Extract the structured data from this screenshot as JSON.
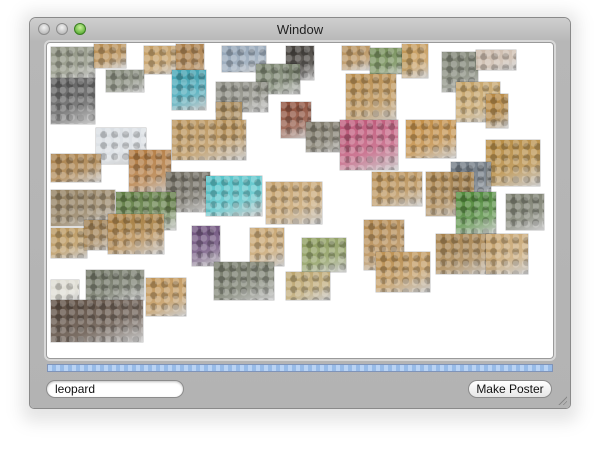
{
  "window": {
    "title": "Window"
  },
  "toolbar": {
    "search_value": "leopard",
    "make_poster_label": "Make Poster"
  },
  "progress": {
    "value": 1.0
  },
  "collage": {
    "photos": [
      {
        "subject": "tank",
        "color": "#8b8f7d"
      },
      {
        "subject": "leopard",
        "color": "#b58a4e"
      },
      {
        "subject": "leopard",
        "color": "#c29a5e"
      },
      {
        "subject": "leopard-pattern",
        "color": "#a97c46"
      },
      {
        "subject": "mountain",
        "color": "#8fa1b4"
      },
      {
        "subject": "black-panther",
        "color": "#3f3b36"
      },
      {
        "subject": "tank",
        "color": "#76806a"
      },
      {
        "subject": "leopard",
        "color": "#b48c55"
      },
      {
        "subject": "woodland",
        "color": "#6f8a52"
      },
      {
        "subject": "leopard",
        "color": "#c49857"
      },
      {
        "subject": "tank",
        "color": "#7a7f6f"
      },
      {
        "subject": "people",
        "color": "#c9b7a7"
      },
      {
        "subject": "pattern-bw",
        "color": "#5c5c5c"
      },
      {
        "subject": "tank",
        "color": "#7d8272"
      },
      {
        "subject": "seal-water",
        "color": "#3ea4b5"
      },
      {
        "subject": "tank",
        "color": "#8a8a80"
      },
      {
        "subject": "leopard",
        "color": "#b88c4c"
      },
      {
        "subject": "leopard",
        "color": "#c5a265"
      },
      {
        "subject": "leopard",
        "color": "#b68742"
      },
      {
        "subject": "book-cover",
        "color": "#8a4a35"
      },
      {
        "subject": "leopard",
        "color": "#a98a5a"
      },
      {
        "subject": "snow",
        "color": "#d8dde2"
      },
      {
        "subject": "leopard",
        "color": "#b99258"
      },
      {
        "subject": "tank",
        "color": "#7a7565"
      },
      {
        "subject": "frog",
        "color": "#c0587a"
      },
      {
        "subject": "leopard",
        "color": "#c08a40"
      },
      {
        "subject": "leopard",
        "color": "#b5893f"
      },
      {
        "subject": "seal",
        "color": "#6c7680"
      },
      {
        "subject": "leopard",
        "color": "#a77d45"
      },
      {
        "subject": "fox",
        "color": "#b2793e"
      },
      {
        "subject": "tank",
        "color": "#6e6a5e"
      },
      {
        "subject": "water",
        "color": "#51c2c8"
      },
      {
        "subject": "leopard",
        "color": "#c4a06a"
      },
      {
        "subject": "leopard",
        "color": "#8f7b5a"
      },
      {
        "subject": "forest",
        "color": "#5c7a3e"
      },
      {
        "subject": "leopard",
        "color": "#b68c50"
      },
      {
        "subject": "leopard",
        "color": "#a9824a"
      },
      {
        "subject": "frog",
        "color": "#4f8a3a"
      },
      {
        "subject": "tank",
        "color": "#777a6a"
      },
      {
        "subject": "leopard",
        "color": "#b79358"
      },
      {
        "subject": "leopard",
        "color": "#9e7c4c"
      },
      {
        "subject": "leopard",
        "color": "#b2864a"
      },
      {
        "subject": "people",
        "color": "#6b4e7a"
      },
      {
        "subject": "leopard",
        "color": "#c6a26c"
      },
      {
        "subject": "grass",
        "color": "#8a9a5a"
      },
      {
        "subject": "leopard",
        "color": "#b3884e"
      },
      {
        "subject": "leopard",
        "color": "#bd9254"
      },
      {
        "subject": "leopard",
        "color": "#a5804a"
      },
      {
        "subject": "leopard",
        "color": "#c7a46f"
      },
      {
        "subject": "tank",
        "color": "#727766"
      },
      {
        "subject": "savanna",
        "color": "#b9a26a"
      },
      {
        "subject": "white-animal",
        "color": "#dcdad0"
      },
      {
        "subject": "tank",
        "color": "#6a6f5e"
      },
      {
        "subject": "leopard",
        "color": "#c09456"
      },
      {
        "subject": "people",
        "color": "#5a4a3e"
      }
    ]
  }
}
